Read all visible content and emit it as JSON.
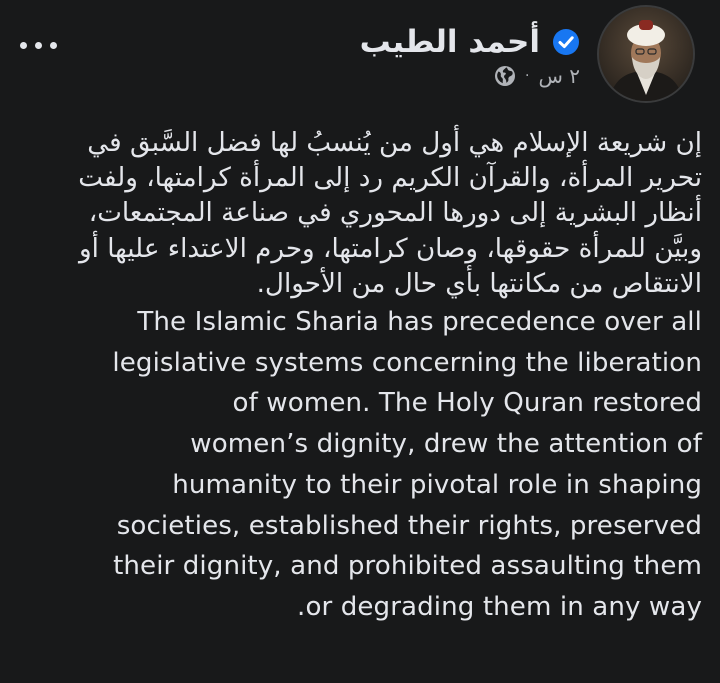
{
  "post": {
    "author": {
      "name": "أحمد الطيب",
      "verified_icon": "verified-badge-icon",
      "avatar_icon": "profile-photo"
    },
    "meta": {
      "time": "٢ س",
      "separator": "·",
      "audience_icon": "globe-icon"
    },
    "more_icon": "more-options-icon",
    "arabic_lines": [
      "إن شريعة الإسلام هي أول من يُنسبُ لها فضل السَّبق في",
      "تحرير المرأة، والقرآن الكريم رد إلى المرأة كرامتها، ولفت",
      "أنظار البشرية إلى دورها المحوري في صناعة المجتمعات،",
      "وبيَّن للمرأة حقوقها، وصان كرامتها، وحرم الاعتداء عليها أو",
      "الانتقاص من مكانتها بأي حال من الأحوال."
    ],
    "english_lines": [
      "The Islamic Sharia has precedence over all",
      "legislative systems concerning the liberation",
      "of women. The Holy Quran restored",
      "women’s dignity, drew the attention of",
      "humanity to their pivotal role in shaping",
      "societies, established their rights, preserved",
      "their dignity, and prohibited assaulting them",
      "or degrading them in any way."
    ]
  },
  "colors": {
    "background": "#18191a",
    "text_primary": "#e4e6eb",
    "text_secondary": "#b0b3b8",
    "verified_blue": "#1877f2"
  }
}
